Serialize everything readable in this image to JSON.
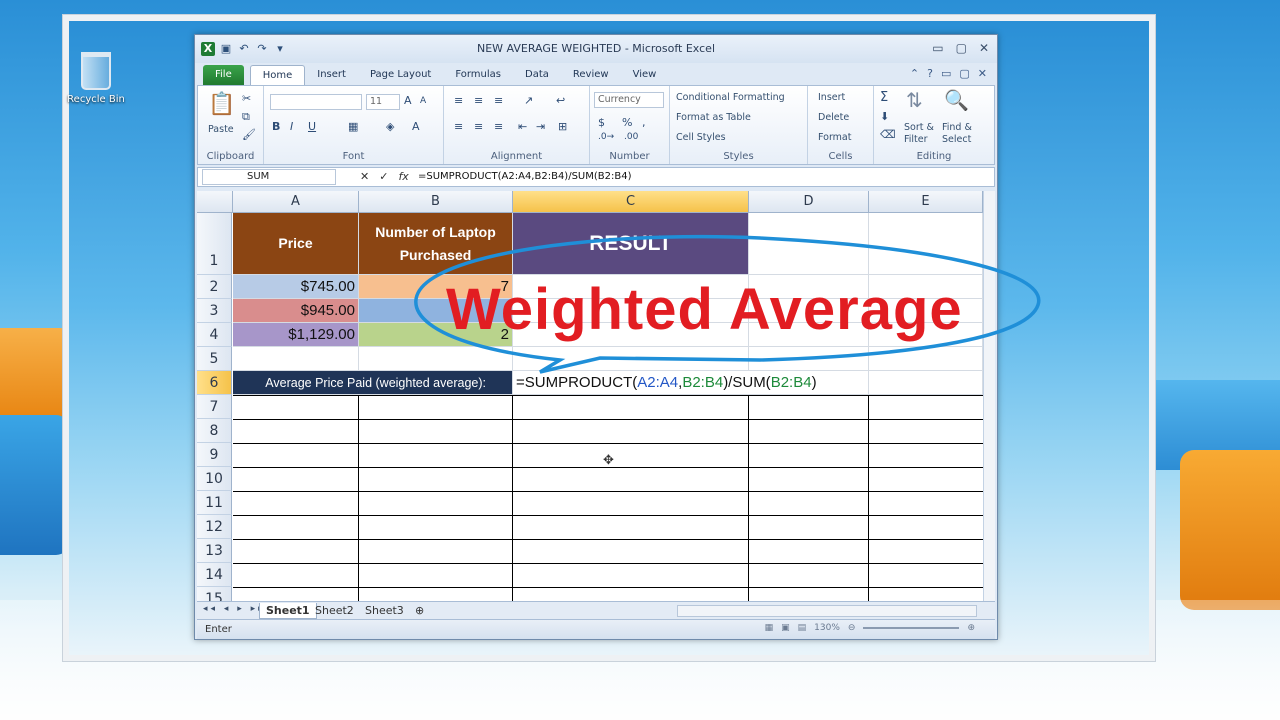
{
  "desktop": {
    "recycle_bin_label": "Recycle Bin"
  },
  "window": {
    "title": "NEW AVERAGE WEIGHTED  -  Microsoft Excel",
    "controls": {
      "minimize": "▭",
      "restore": "▢",
      "close": "✕"
    }
  },
  "ribbon": {
    "tabs": [
      "File",
      "Home",
      "Insert",
      "Page Layout",
      "Formulas",
      "Data",
      "Review",
      "View"
    ],
    "active_tab": "Home",
    "groups": {
      "clipboard": {
        "label": "Clipboard",
        "paste": "Paste"
      },
      "font": {
        "label": "Font",
        "size": "11",
        "bold": "B",
        "italic": "I",
        "underline": "U"
      },
      "alignment": {
        "label": "Alignment"
      },
      "number": {
        "label": "Number",
        "format": "Currency",
        "dollar": "$",
        "percent": "%",
        "comma": ","
      },
      "styles": {
        "label": "Styles",
        "conditional": "Conditional Formatting",
        "format_table": "Format as Table",
        "cell_styles": "Cell Styles"
      },
      "cells": {
        "label": "Cells",
        "insert": "Insert",
        "delete": "Delete",
        "format": "Format"
      },
      "editing": {
        "label": "Editing",
        "sigma": "Σ",
        "sort": "Sort &",
        "filter": "Filter",
        "find": "Find &",
        "select": "Select"
      }
    }
  },
  "formula_bar": {
    "name_box": "SUM",
    "fx": "fx",
    "cancel": "✕",
    "enter": "✓",
    "formula": "=SUMPRODUCT(A2:A4,B2:B4)/SUM(B2:B4)"
  },
  "grid": {
    "columns": [
      "A",
      "B",
      "C",
      "D",
      "E"
    ],
    "rows": [
      "1",
      "2",
      "3",
      "4",
      "5",
      "6",
      "7",
      "8",
      "9",
      "10",
      "11",
      "12",
      "13",
      "14",
      "15"
    ],
    "header_price": "Price",
    "header_laptops_line1": "Number of Laptop",
    "header_laptops_line2": "Purchased",
    "header_result": "RESULT",
    "prices": [
      "$745.00",
      "$945.00",
      "$1,129.00"
    ],
    "quantities_visible": [
      "7",
      "",
      "2"
    ],
    "avg_label": "Average Price Paid (weighted average):",
    "edit_formula_parts": {
      "prefix": "=SUMPRODUCT(",
      "range1": "A2:A4",
      "comma": ",",
      "range2": "B2:B4",
      "mid": ")/SUM(",
      "range3": "B2:B4",
      "suffix": ")"
    }
  },
  "sheets": [
    "Sheet1",
    "Sheet2",
    "Sheet3"
  ],
  "active_sheet": "Sheet1",
  "status": {
    "mode": "Enter",
    "zoom": "130%"
  },
  "overlay": {
    "text": "Weighted Average"
  },
  "colors": {
    "price_header": "#8b4513",
    "result_header": "#5a4a80",
    "price_row2": "#b7cbe6",
    "price_row3": "#d98d8d",
    "price_row4": "#a796c9",
    "qty_row2": "#f7bf8f",
    "qty_row3": "#8fb3df",
    "qty_row4": "#b9d38c",
    "avg_row": "#1f3457",
    "overlay_red": "#e21d22",
    "ellipse_blue": "#1f8fd8"
  }
}
